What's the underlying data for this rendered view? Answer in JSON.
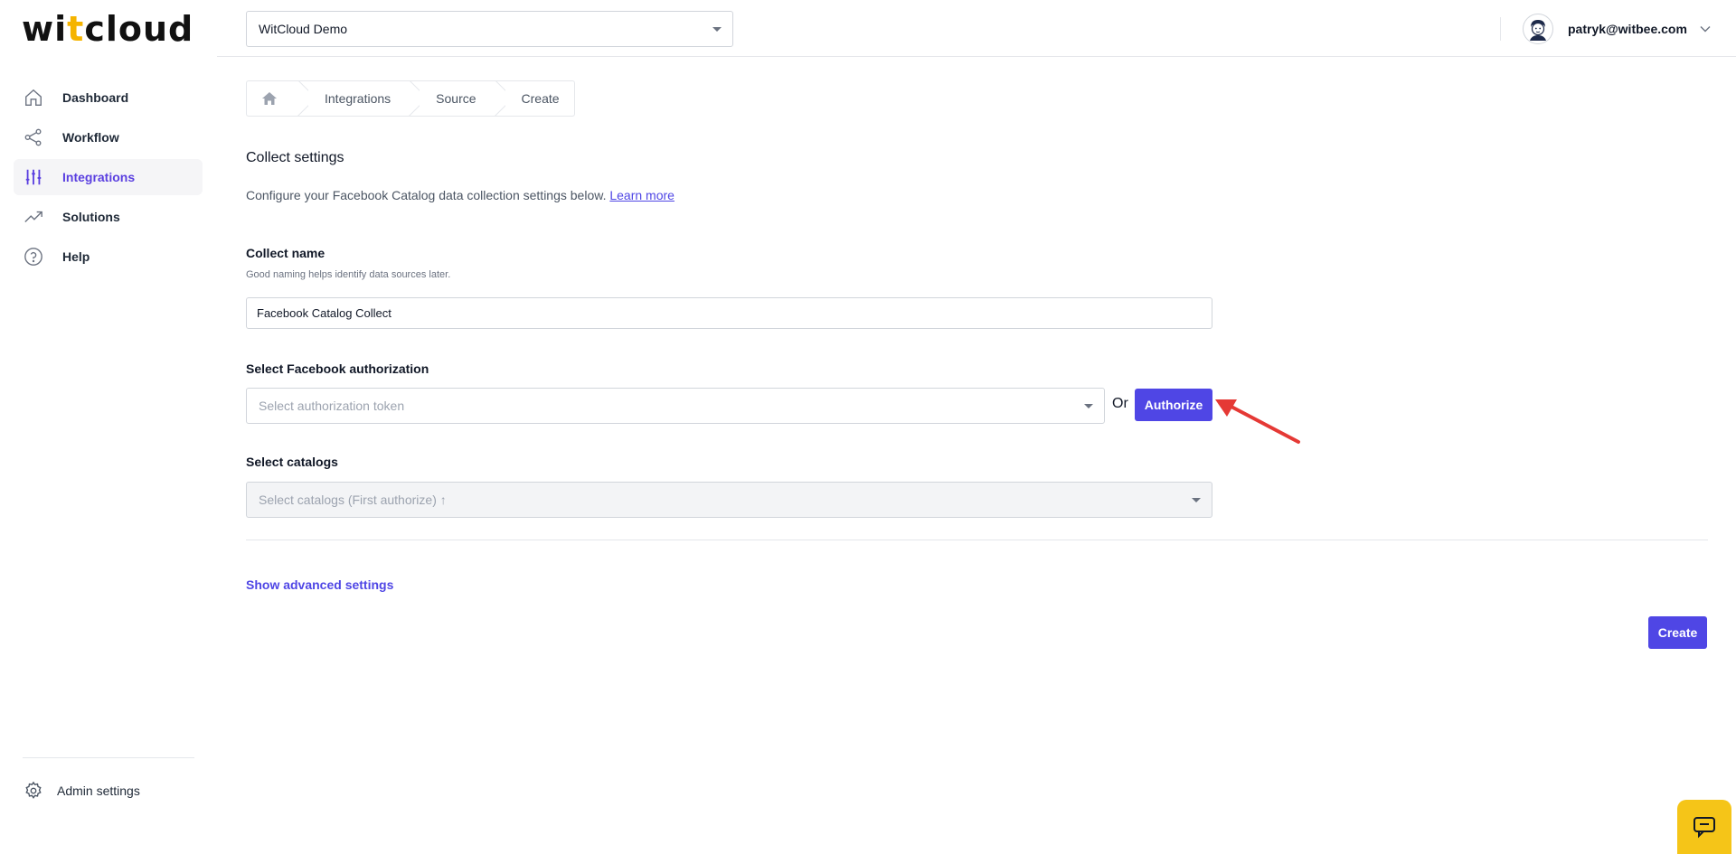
{
  "brand": {
    "logo_a": "wi",
    "logo_dot": "t",
    "logo_b": "cloud"
  },
  "sidebar": {
    "items": [
      {
        "label": "Dashboard",
        "icon": "home-icon",
        "active": false
      },
      {
        "label": "Workflow",
        "icon": "share-icon",
        "active": false
      },
      {
        "label": "Integrations",
        "icon": "sliders-icon",
        "active": true
      },
      {
        "label": "Solutions",
        "icon": "trending-up-icon",
        "active": false
      },
      {
        "label": "Help",
        "icon": "help-circle-icon",
        "active": false
      }
    ],
    "admin_label": "Admin settings"
  },
  "header": {
    "project": "WitCloud Demo",
    "user_email": "patryk@witbee.com"
  },
  "breadcrumb": [
    "Integrations",
    "Source",
    "Create"
  ],
  "form": {
    "title": "Collect settings",
    "description": "Configure your Facebook Catalog data collection settings below.",
    "learn_more": "Learn more",
    "name_label": "Collect name",
    "name_help": "Good naming helps identify data sources later.",
    "name_value": "Facebook Catalog Collect",
    "auth_label": "Select Facebook authorization",
    "auth_placeholder": "Select authorization token",
    "or_text": "Or",
    "authorize_label": "Authorize",
    "catalogs_label": "Select catalogs",
    "catalogs_placeholder": "Select catalogs (First authorize) ↑",
    "advanced_link": "Show advanced settings",
    "create_label": "Create"
  },
  "colors": {
    "accent": "#4f46e5",
    "active_nav": "#5a3fe0",
    "annotation": "#e53935",
    "chat": "#f5c518"
  }
}
